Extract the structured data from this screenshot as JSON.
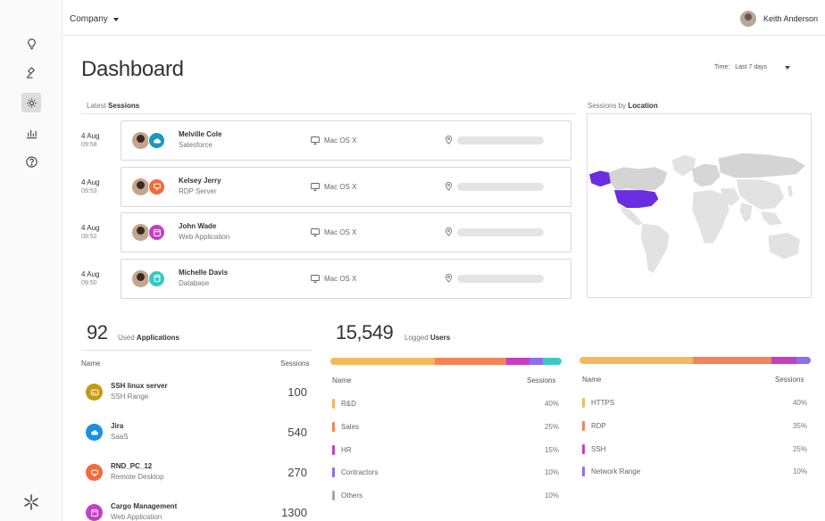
{
  "topbar": {
    "company_label": "Company",
    "user_name": "Keith Anderson"
  },
  "page": {
    "title": "Dashboard",
    "time_label": "Time:",
    "time_value": "Last 7 days"
  },
  "sessions": {
    "label_prefix": "Latest",
    "label_bold": "Sessions",
    "rows": [
      {
        "date": "4 Aug",
        "time": "09:58",
        "name": "Melville Cole",
        "app": "Salesforce",
        "os": "Mac OS X",
        "badge_color": "#1798c1",
        "badge_icon": "cloud-icon"
      },
      {
        "date": "4 Aug",
        "time": "09:53",
        "name": "Kelsey Jerry",
        "app": "RDP Server",
        "os": "Mac OS X",
        "badge_color": "#f26b3a",
        "badge_icon": "remote-desktop-icon"
      },
      {
        "date": "4 Aug",
        "time": "09:52",
        "name": "John Wade",
        "app": "Web Application",
        "os": "Mac OS X",
        "badge_color": "#c341c3",
        "badge_icon": "browser-icon"
      },
      {
        "date": "4 Aug",
        "time": "09:50",
        "name": "Michelle Davis",
        "app": "Database",
        "os": "Mac OS X",
        "badge_color": "#35c9c2",
        "badge_icon": "database-icon"
      }
    ]
  },
  "location": {
    "label_prefix": "Sessions by",
    "label_bold": "Location",
    "highlight_color": "#6a2ddf",
    "land_color": "#e2e2e2"
  },
  "applications": {
    "count": "92",
    "label_prefix": "Used",
    "label_bold": "Applications",
    "col_name": "Name",
    "col_sessions": "Sessions",
    "rows": [
      {
        "name": "SSH linux server",
        "sub": "SSH Range",
        "value": "100",
        "color": "#c49a12",
        "icon": "terminal-icon"
      },
      {
        "name": "Jira",
        "sub": "SaaS",
        "value": "540",
        "color": "#1a8fe3",
        "icon": "cloud-icon"
      },
      {
        "name": "RND_PC_12",
        "sub": "Remote Desktop",
        "value": "270",
        "color": "#f26b3a",
        "icon": "remote-desktop-icon"
      },
      {
        "name": "Cargo Management",
        "sub": "Web Application",
        "value": "1300",
        "color": "#c341c3",
        "icon": "browser-icon"
      }
    ]
  },
  "users": {
    "count": "15,549",
    "label_prefix": "Logged",
    "label_bold": "Users",
    "col_name": "Name",
    "col_sessions": "Sessions",
    "bar": [
      {
        "share": 0.45,
        "color": "#f5b95b"
      },
      {
        "share": 0.31,
        "color": "#f5835a"
      },
      {
        "share": 0.1,
        "color": "#c63fc0"
      },
      {
        "share": 0.06,
        "color": "#8c6ef0"
      },
      {
        "share": 0.08,
        "color": "#3cc9c2"
      }
    ],
    "rows": [
      {
        "name": "R&D",
        "pct": "40%",
        "color": "#f5b95b"
      },
      {
        "name": "Sales",
        "pct": "25%",
        "color": "#f5835a"
      },
      {
        "name": "HR",
        "pct": "15%",
        "color": "#c63fc0"
      },
      {
        "name": "Contractors",
        "pct": "10%",
        "color": "#8c6ef0"
      },
      {
        "name": "Others",
        "pct": "10%",
        "color": "#a8a8a8"
      }
    ]
  },
  "protocols": {
    "col_name": "Name",
    "col_sessions": "Sessions",
    "bar": [
      {
        "share": 0.49,
        "color": "#f5b95b"
      },
      {
        "share": 0.34,
        "color": "#f5835a"
      },
      {
        "share": 0.11,
        "color": "#c63fc0"
      },
      {
        "share": 0.06,
        "color": "#8c6ef0"
      }
    ],
    "rows": [
      {
        "name": "HTTPS",
        "pct": "40%",
        "color": "#f5b95b"
      },
      {
        "name": "RDP",
        "pct": "35%",
        "color": "#f5835a"
      },
      {
        "name": "SSH",
        "pct": "25%",
        "color": "#c63fc0"
      },
      {
        "name": "Network Range",
        "pct": "10%",
        "color": "#8c6ef0"
      }
    ]
  }
}
